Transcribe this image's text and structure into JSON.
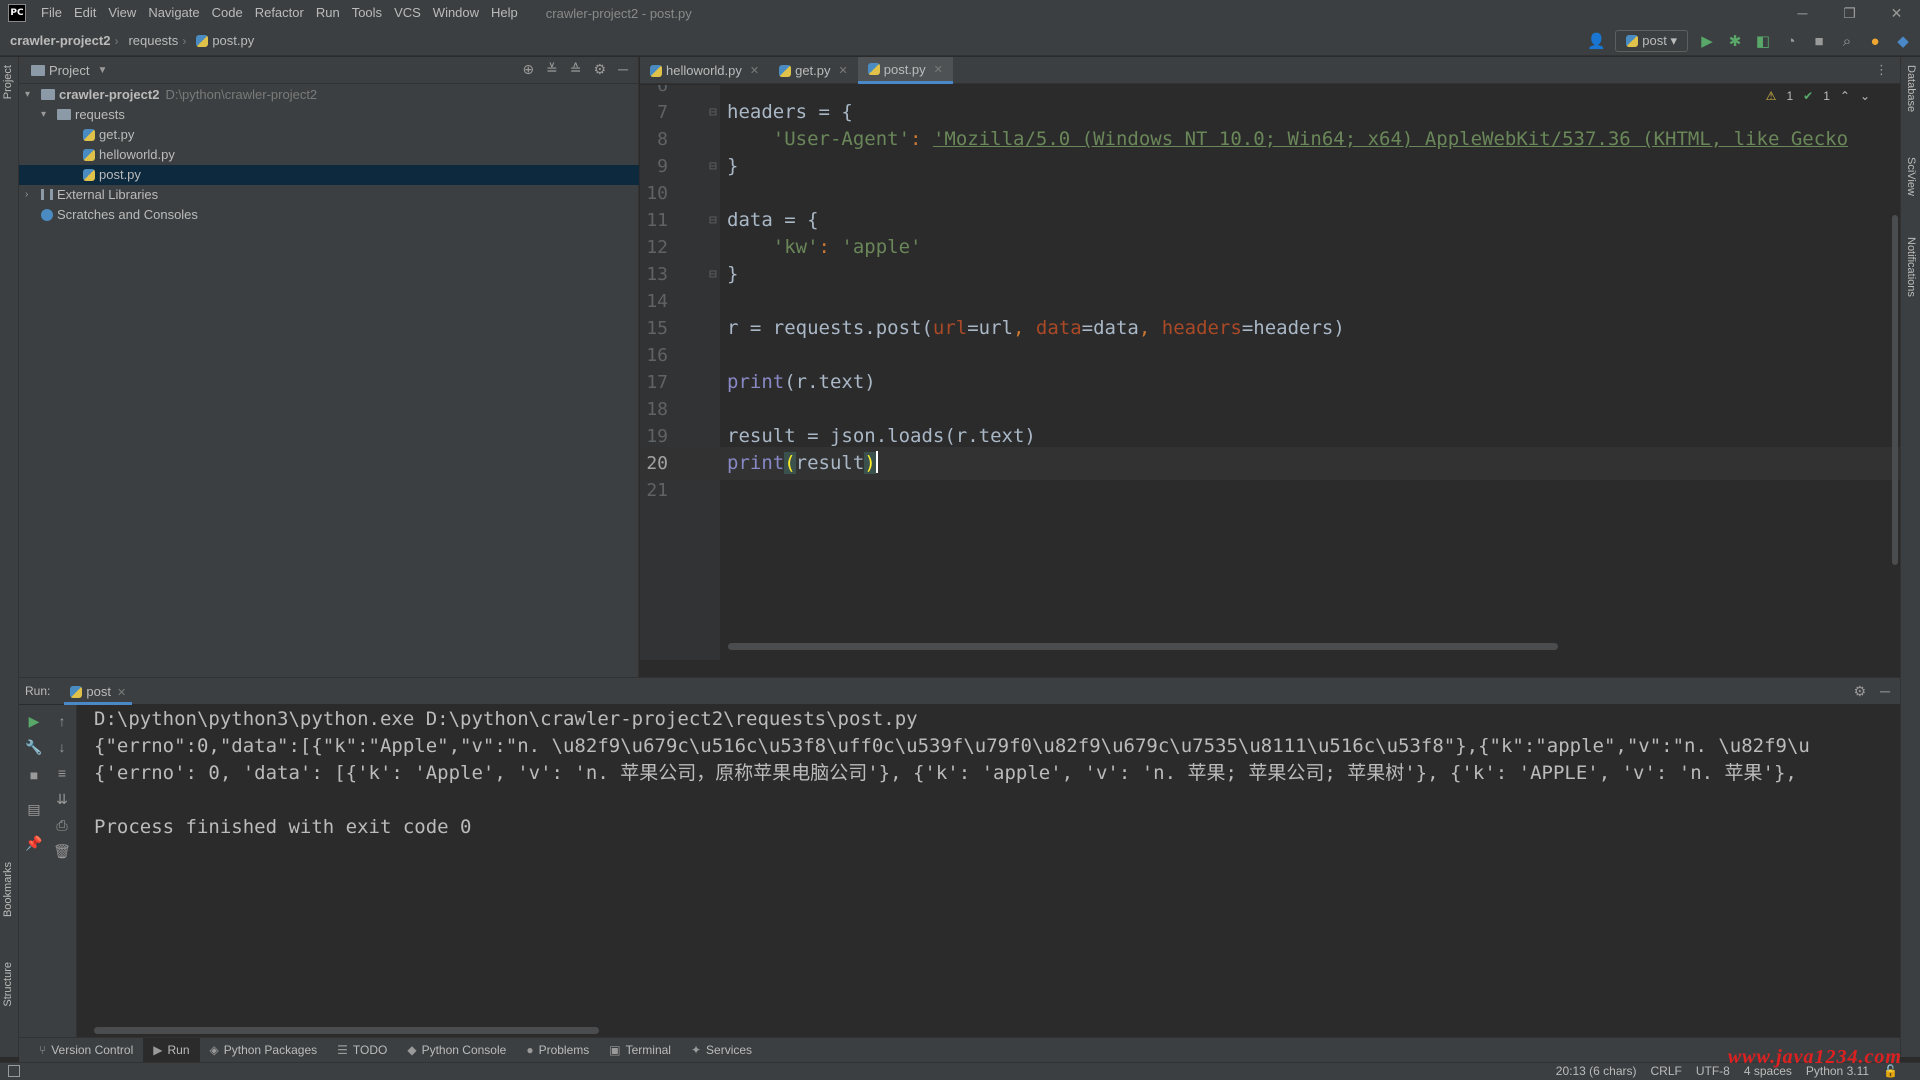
{
  "app": {
    "logo": "PC",
    "title": "crawler-project2 - post.py",
    "menu": [
      "File",
      "Edit",
      "View",
      "Navigate",
      "Code",
      "Refactor",
      "Run",
      "Tools",
      "VCS",
      "Window",
      "Help"
    ]
  },
  "breadcrumb": [
    "crawler-project2",
    "requests",
    "post.py"
  ],
  "run_config": "post",
  "left_stripe": [
    "Project",
    "Bookmarks",
    "Structure"
  ],
  "right_stripe": [
    "Database",
    "SciView",
    "Notifications"
  ],
  "project_panel": {
    "title": "Project",
    "tree": [
      {
        "label": "crawler-project2",
        "hint": "D:\\python\\crawler-project2",
        "type": "root"
      },
      {
        "label": "requests",
        "type": "folder"
      },
      {
        "label": "get.py",
        "type": "file"
      },
      {
        "label": "helloworld.py",
        "type": "file"
      },
      {
        "label": "post.py",
        "type": "file",
        "selected": true
      },
      {
        "label": "External Libraries",
        "type": "lib"
      },
      {
        "label": "Scratches and Consoles",
        "type": "scratch"
      }
    ]
  },
  "editor": {
    "tabs": [
      {
        "label": "helloworld.py",
        "active": false
      },
      {
        "label": "get.py",
        "active": false
      },
      {
        "label": "post.py",
        "active": true
      }
    ],
    "inspection": {
      "warnings": "1",
      "ok": "1"
    },
    "current_line": 20,
    "lines": [
      {
        "n": "6",
        "tokens": []
      },
      {
        "n": "7",
        "fold": true,
        "tokens": [
          {
            "c": "plain",
            "t": "headers = {"
          }
        ]
      },
      {
        "n": "8",
        "tokens": [
          {
            "c": "plain",
            "t": "    "
          },
          {
            "c": "str",
            "t": "'User-Agent'"
          },
          {
            "c": "kw",
            "t": ": "
          },
          {
            "c": "str-ul",
            "t": "'Mozilla/5.0 (Windows NT 10.0; Win64; x64) AppleWebKit/537.36 (KHTML, like Gecko"
          }
        ]
      },
      {
        "n": "9",
        "fold": true,
        "tokens": [
          {
            "c": "plain",
            "t": "}"
          }
        ]
      },
      {
        "n": "10",
        "tokens": []
      },
      {
        "n": "11",
        "fold": true,
        "tokens": [
          {
            "c": "plain",
            "t": "data = {"
          }
        ]
      },
      {
        "n": "12",
        "tokens": [
          {
            "c": "plain",
            "t": "    "
          },
          {
            "c": "str",
            "t": "'kw'"
          },
          {
            "c": "kw",
            "t": ": "
          },
          {
            "c": "str",
            "t": "'apple'"
          }
        ]
      },
      {
        "n": "13",
        "fold": true,
        "tokens": [
          {
            "c": "plain",
            "t": "}"
          }
        ]
      },
      {
        "n": "14",
        "tokens": []
      },
      {
        "n": "15",
        "tokens": [
          {
            "c": "plain",
            "t": "r = requests.post("
          },
          {
            "c": "param",
            "t": "url"
          },
          {
            "c": "plain",
            "t": "=url"
          },
          {
            "c": "kw",
            "t": ", "
          },
          {
            "c": "param",
            "t": "data"
          },
          {
            "c": "plain",
            "t": "=data"
          },
          {
            "c": "kw",
            "t": ", "
          },
          {
            "c": "param",
            "t": "headers"
          },
          {
            "c": "plain",
            "t": "=headers)"
          }
        ]
      },
      {
        "n": "16",
        "tokens": []
      },
      {
        "n": "17",
        "tokens": [
          {
            "c": "fn",
            "t": "print"
          },
          {
            "c": "plain",
            "t": "(r.text)"
          }
        ]
      },
      {
        "n": "18",
        "tokens": []
      },
      {
        "n": "19",
        "tokens": [
          {
            "c": "plain",
            "t": "result = json.loads(r.text)"
          }
        ]
      },
      {
        "n": "20",
        "tokens": [
          {
            "c": "fn",
            "t": "print"
          },
          {
            "c": "hl",
            "t": "("
          },
          {
            "c": "plain",
            "t": "result"
          },
          {
            "c": "hl",
            "t": ")"
          },
          {
            "c": "caret",
            "t": ""
          }
        ]
      },
      {
        "n": "21",
        "tokens": []
      }
    ]
  },
  "run": {
    "label": "Run:",
    "tab": "post",
    "output": [
      "D:\\python\\python3\\python.exe D:\\python\\crawler-project2\\requests\\post.py",
      "{\"errno\":0,\"data\":[{\"k\":\"Apple\",\"v\":\"n. \\u82f9\\u679c\\u516c\\u53f8\\uff0c\\u539f\\u79f0\\u82f9\\u679c\\u7535\\u8111\\u516c\\u53f8\"},{\"k\":\"apple\",\"v\":\"n. \\u82f9\\u",
      "{'errno': 0, 'data': [{'k': 'Apple', 'v': 'n. 苹果公司，原称苹果电脑公司'}, {'k': 'apple', 'v': 'n. 苹果; 苹果公司; 苹果树'}, {'k': 'APPLE', 'v': 'n. 苹果'},",
      "",
      "Process finished with exit code 0"
    ]
  },
  "tool_strip": [
    {
      "label": "Version Control",
      "glyph": "⑂"
    },
    {
      "label": "Run",
      "glyph": "▶",
      "active": true
    },
    {
      "label": "Python Packages",
      "glyph": "◈"
    },
    {
      "label": "TODO",
      "glyph": "☰"
    },
    {
      "label": "Python Console",
      "glyph": "◆"
    },
    {
      "label": "Problems",
      "glyph": "●"
    },
    {
      "label": "Terminal",
      "glyph": "▣"
    },
    {
      "label": "Services",
      "glyph": "✦"
    }
  ],
  "status": {
    "position": "20:13 (6 chars)",
    "line_sep": "CRLF",
    "encoding": "UTF-8",
    "indent": "4 spaces",
    "interpreter": "Python 3.11",
    "watermark": "www.java1234.com"
  }
}
